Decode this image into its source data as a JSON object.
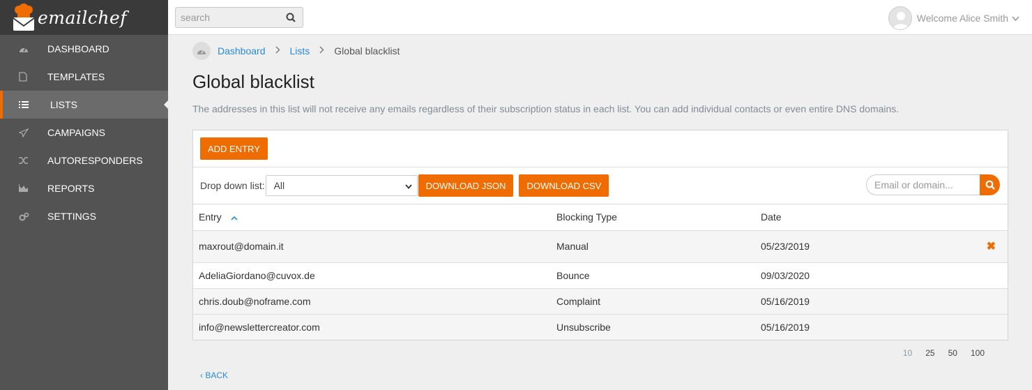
{
  "brand": {
    "name": "emailchef",
    "accent": "#ef6c00"
  },
  "sidebar": {
    "items": [
      {
        "label": "DASHBOARD",
        "icon": "dashboard-icon"
      },
      {
        "label": "TEMPLATES",
        "icon": "file-icon"
      },
      {
        "label": "LISTS",
        "icon": "list-icon",
        "active": true
      },
      {
        "label": "CAMPAIGNS",
        "icon": "paper-plane-icon"
      },
      {
        "label": "AUTORESPONDERS",
        "icon": "shuffle-icon"
      },
      {
        "label": "REPORTS",
        "icon": "area-chart-icon"
      },
      {
        "label": "SETTINGS",
        "icon": "gears-icon"
      }
    ]
  },
  "topbar": {
    "search_placeholder": "search",
    "welcome": "Welcome Alice Smith"
  },
  "breadcrumb": {
    "dashboard": "Dashboard",
    "lists": "Lists",
    "current": "Global blacklist"
  },
  "page": {
    "title": "Global blacklist",
    "description": "The addresses in this list will not receive any emails regardless of their subscription status in each list. You can add individual contacts or even entire DNS domains."
  },
  "panel": {
    "add_entry": "ADD ENTRY",
    "dropdown_label": "Drop down list:",
    "dropdown_value": "All",
    "download_json": "DOWNLOAD JSON",
    "download_csv": "DOWNLOAD CSV",
    "filter_placeholder": "Email or domain..."
  },
  "table": {
    "headers": {
      "entry": "Entry",
      "type": "Blocking Type",
      "date": "Date"
    },
    "rows": [
      {
        "entry": "maxrout@domain.it",
        "type": "Manual",
        "date": "05/23/2019"
      },
      {
        "entry": "AdeliaGiordano@cuvox.de",
        "type": "Bounce",
        "date": "09/03/2020"
      },
      {
        "entry": "chris.doub@noframe.com",
        "type": "Complaint",
        "date": "05/16/2019"
      },
      {
        "entry": "info@newslettercreator.com",
        "type": "Unsubscribe",
        "date": "05/16/2019"
      }
    ]
  },
  "pager": {
    "sizes": [
      "10",
      "25",
      "50",
      "100"
    ],
    "active": "10"
  },
  "back_label": "BACK"
}
